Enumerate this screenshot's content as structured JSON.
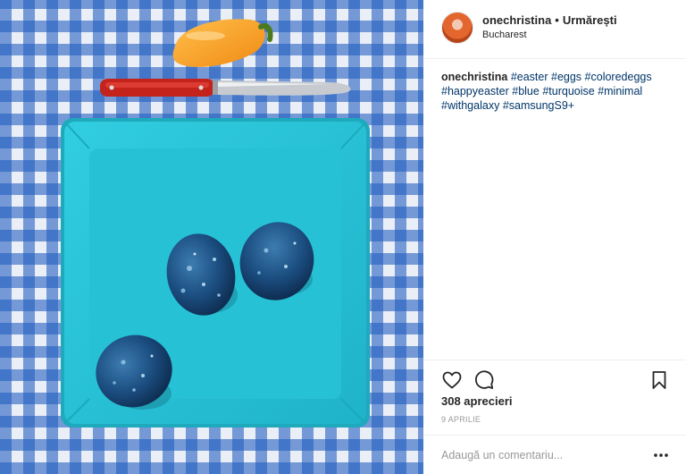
{
  "post": {
    "image_alt": "Blue dyed Easter eggs on a turquoise plate on a blue gingham tablecloth, with a knife and a yellow pepper",
    "author": {
      "username": "onechristina",
      "separator": "•",
      "follow_label": "Urmărești",
      "location": "Bucharest"
    },
    "caption": {
      "username": "onechristina",
      "hashtags": [
        "#easter",
        "#eggs",
        "#coloredeggs",
        "#happyeaster",
        "#blue",
        "#turquoise",
        "#minimal",
        "#withgalaxy",
        "#samsungS9+"
      ]
    },
    "likes": "308 aprecieri",
    "date": "9 APRILIE",
    "comment": {
      "placeholder": "Adaugă un comentariu...",
      "value": ""
    },
    "icons": {
      "like": "heart-icon",
      "comment": "comment-bubble-icon",
      "save": "bookmark-icon",
      "more": "more-options-icon"
    },
    "colors": {
      "hashtag": "#003569",
      "tablecloth": "#1f5cbe",
      "plate": "#27c1d6",
      "egg": "#1c4f82",
      "pepper": "#f7a323"
    }
  }
}
